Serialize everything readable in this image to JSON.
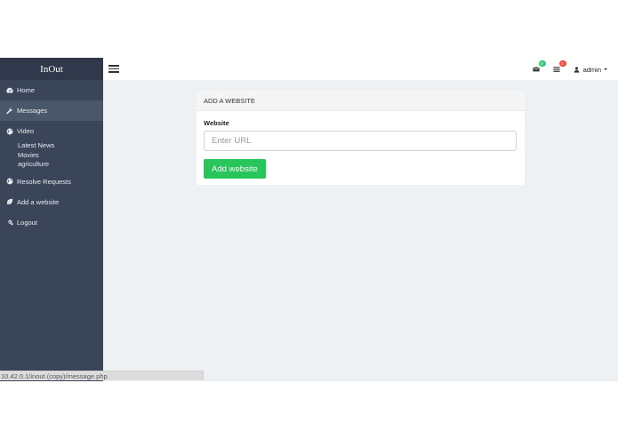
{
  "brand": "InOut",
  "sidebar": {
    "items": [
      {
        "label": "Home",
        "icon": "dashboard-icon"
      },
      {
        "label": "Messages",
        "icon": "wrench-icon"
      },
      {
        "label": "Video",
        "icon": "globe-icon"
      },
      {
        "label": "Resolve Requests",
        "icon": "globe-icon"
      },
      {
        "label": "Add a website",
        "icon": "leaf-icon"
      },
      {
        "label": "Logout",
        "icon": "gears-icon"
      }
    ],
    "video_subitems": [
      "Latest News",
      "Movies",
      "agriculture"
    ]
  },
  "topbar": {
    "messages_badge": "0",
    "tasks_badge": "0",
    "user": "admin"
  },
  "panel": {
    "heading": "ADD A WEBSITE",
    "field_label": "Website",
    "input_placeholder": "Enter URL",
    "button_label": "Add website"
  },
  "status_url": "10.42.0.1/inout (copy)/message.php",
  "colors": {
    "sidebar_bg": "#3a4559",
    "brand_bg": "#2f394b",
    "accent_green": "#27c55a",
    "badge_red": "#e74c3c"
  }
}
